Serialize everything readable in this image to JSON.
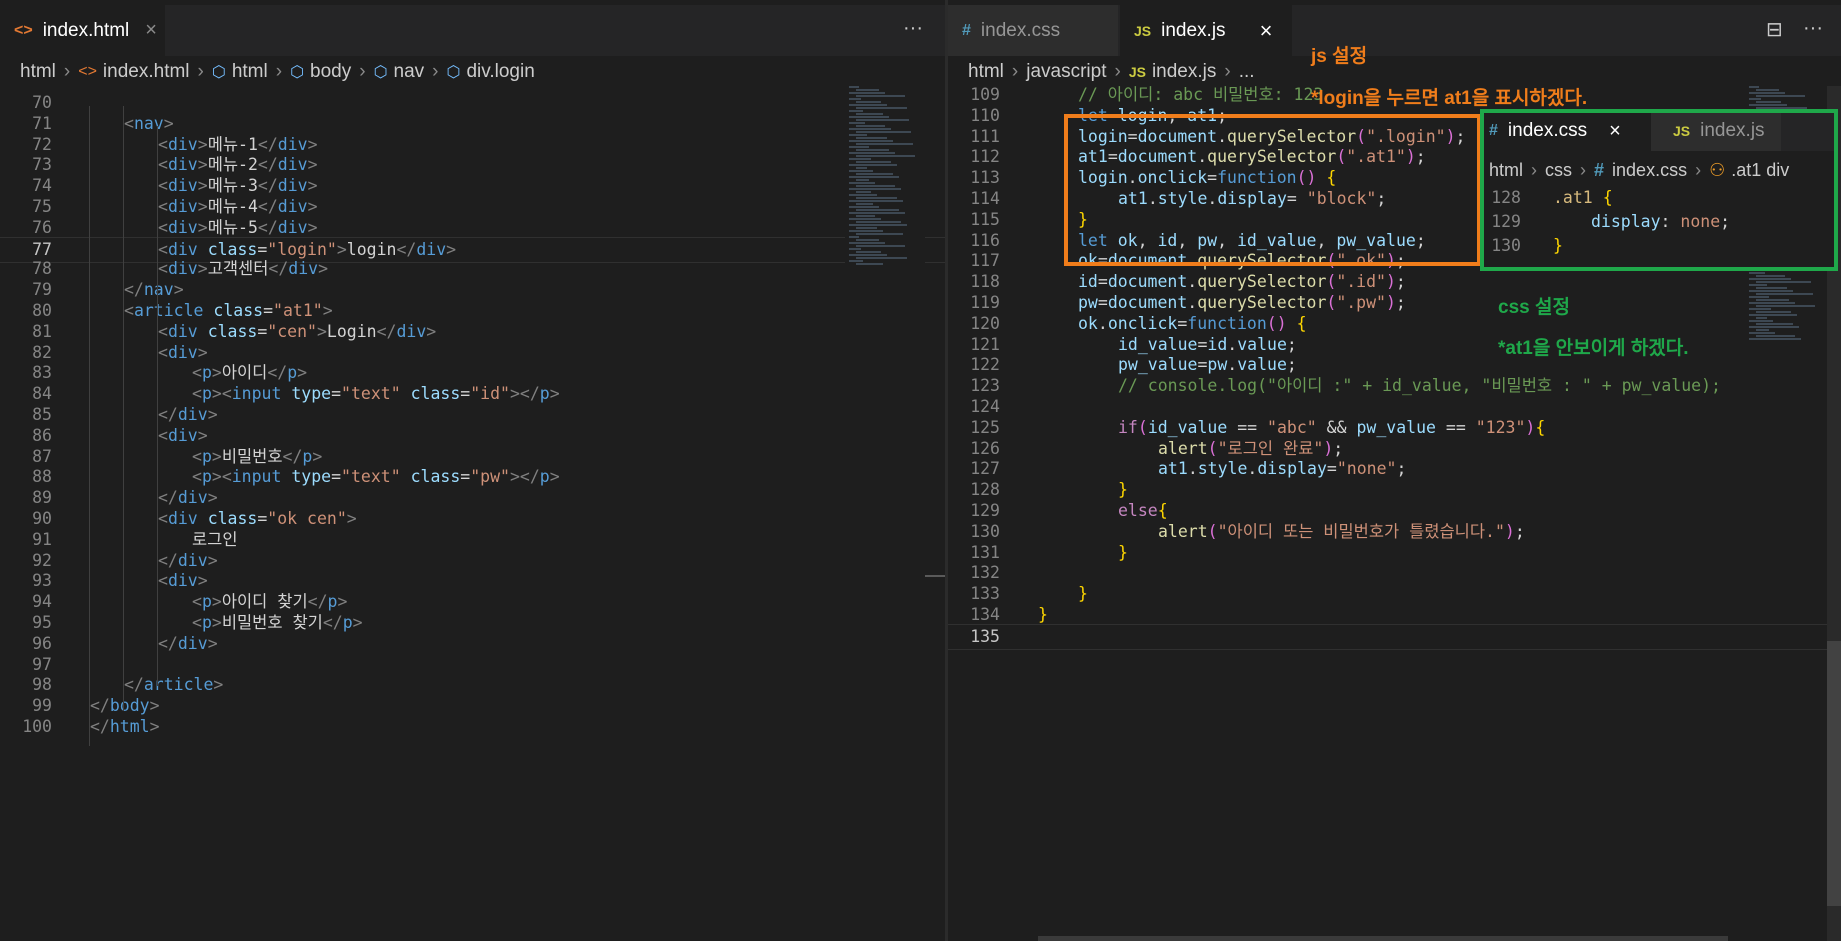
{
  "left_editor": {
    "tab": {
      "icon": "<>",
      "label": "index.html",
      "close": "×"
    },
    "more": "···",
    "breadcrumb": [
      "html",
      "index.html",
      "html",
      "body",
      "nav",
      "div.login"
    ],
    "lines": [
      {
        "n": "70",
        "c": ""
      },
      {
        "n": "71",
        "c": "<nav>"
      },
      {
        "n": "72",
        "c": "<div>메뉴-1</div>"
      },
      {
        "n": "73",
        "c": "<div>메뉴-2</div>"
      },
      {
        "n": "74",
        "c": "<div>메뉴-3</div>"
      },
      {
        "n": "75",
        "c": "<div>메뉴-4</div>"
      },
      {
        "n": "76",
        "c": "<div>메뉴-5</div>"
      },
      {
        "n": "77",
        "c": "<div class=\"login\">login</div>"
      },
      {
        "n": "78",
        "c": "<div>고객센터</div>"
      },
      {
        "n": "79",
        "c": "</nav>"
      },
      {
        "n": "80",
        "c": "<article class=\"at1\">"
      },
      {
        "n": "81",
        "c": "<div class=\"cen\">Login</div>"
      },
      {
        "n": "82",
        "c": "<div>"
      },
      {
        "n": "83",
        "c": "<p>아이디</p>"
      },
      {
        "n": "84",
        "c": "<p><input type=\"text\" class=\"id\"></p>"
      },
      {
        "n": "85",
        "c": "</div>"
      },
      {
        "n": "86",
        "c": "<div>"
      },
      {
        "n": "87",
        "c": "<p>비밀번호</p>"
      },
      {
        "n": "88",
        "c": "<p><input type=\"text\" class=\"pw\"></p>"
      },
      {
        "n": "89",
        "c": "</div>"
      },
      {
        "n": "90",
        "c": "<div class=\"ok cen\">"
      },
      {
        "n": "91",
        "c": "로그인"
      },
      {
        "n": "92",
        "c": "</div>"
      },
      {
        "n": "93",
        "c": "<div>"
      },
      {
        "n": "94",
        "c": "<p>아이디 찾기</p>"
      },
      {
        "n": "95",
        "c": "<p>비밀번호 찾기</p>"
      },
      {
        "n": "96",
        "c": "</div>"
      },
      {
        "n": "97",
        "c": ""
      },
      {
        "n": "98",
        "c": "</article>"
      },
      {
        "n": "99",
        "c": "</body>"
      },
      {
        "n": "100",
        "c": "</html>"
      }
    ]
  },
  "right_editor": {
    "tabs": [
      {
        "icon": "#",
        "label": "index.css"
      },
      {
        "icon": "JS",
        "label": "index.js",
        "close": "×"
      }
    ],
    "split_icon": "⊟",
    "more": "···",
    "breadcrumb": [
      "html",
      "javascript",
      "JS",
      "index.js",
      "..."
    ],
    "lines": [
      {
        "n": "109",
        "c": "// 아이디: abc 비밀번호: 123"
      },
      {
        "n": "110",
        "c": "let login, at1;"
      },
      {
        "n": "111",
        "c": "login=document.querySelector(\".login\");"
      },
      {
        "n": "112",
        "c": "at1=document.querySelector(\".at1\");"
      },
      {
        "n": "113",
        "c": "login.onclick=function() {"
      },
      {
        "n": "114",
        "c": "at1.style.display= \"block\";"
      },
      {
        "n": "115",
        "c": "}"
      },
      {
        "n": "116",
        "c": "let ok, id, pw, id_value, pw_value;"
      },
      {
        "n": "117",
        "c": "ok=document.querySelector(\".ok\");"
      },
      {
        "n": "118",
        "c": "id=document.querySelector(\".id\");"
      },
      {
        "n": "119",
        "c": "pw=document.querySelector(\".pw\");"
      },
      {
        "n": "120",
        "c": "ok.onclick=function() {"
      },
      {
        "n": "121",
        "c": "id_value=id.value;"
      },
      {
        "n": "122",
        "c": "pw_value=pw.value;"
      },
      {
        "n": "123",
        "c": "// console.log(\"아이디 :\" + id_value, \"비밀번호 : \" + pw_value);"
      },
      {
        "n": "124",
        "c": ""
      },
      {
        "n": "125",
        "c": "if(id_value == \"abc\" && pw_value == \"123\"){"
      },
      {
        "n": "126",
        "c": "alert(\"로그인 완료\");"
      },
      {
        "n": "127",
        "c": "at1.style.display=\"none\";"
      },
      {
        "n": "128",
        "c": "}"
      },
      {
        "n": "129",
        "c": "else{"
      },
      {
        "n": "130",
        "c": "alert(\"아이디 또는 비밀번호가 틀렸습니다.\");"
      },
      {
        "n": "131",
        "c": "}"
      },
      {
        "n": "132",
        "c": ""
      },
      {
        "n": "133",
        "c": "}"
      },
      {
        "n": "134",
        "c": "}"
      },
      {
        "n": "135",
        "c": ""
      }
    ]
  },
  "css_peek": {
    "tabs": [
      {
        "icon": "#",
        "label": "index.css",
        "close": "×"
      },
      {
        "icon": "JS",
        "label": "index.js"
      }
    ],
    "breadcrumb": [
      "html",
      "css",
      "#",
      "index.css",
      ".at1 div"
    ],
    "lines": [
      {
        "n": "128",
        "c": ".at1 {"
      },
      {
        "n": "129",
        "c": "display: none;"
      },
      {
        "n": "130",
        "c": "}"
      }
    ]
  },
  "annotations": {
    "js_title": "js 설정",
    "js_desc": "*login을 누르면 at1을 표시하겠다.",
    "css_title": "css 설정",
    "css_desc": "*at1을 안보이게 하겠다."
  },
  "colors": {
    "orange": "#f07d1b",
    "green": "#1fa84a"
  }
}
